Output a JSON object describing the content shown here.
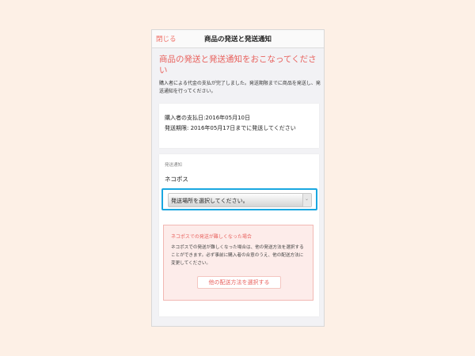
{
  "navbar": {
    "close_label": "閉じる",
    "title": "商品の発送と発送通知"
  },
  "main": {
    "heading": "商品の発送と発送通知をおこなってください",
    "description": "購入者による代金の支払が完了しました。発送期限までに商品を発送し、発送通知を行ってください。"
  },
  "payment": {
    "paid_line": "購入者の支払日:2016年05月10日",
    "deadline_line": "発送期限: 2016年05月17日までに発送してください"
  },
  "shipping": {
    "label": "発送通知",
    "method": "ネコポス",
    "select_placeholder": "発送場所を選択してください。"
  },
  "alert": {
    "title": "ネコポスでの発送が難しくなった場合",
    "body": "ネコポスでの発送が難しくなった場合は、他の発送方法を選択することができます。必ず事前に購入者の合意のうえ、他の配送方法に変更してください。",
    "button_label": "他の配送方法を選択する"
  },
  "colors": {
    "accent": "#e8625e",
    "highlight": "#1aa7e0",
    "background": "#fdf0e6"
  },
  "icons": {
    "select_arrow": "chevron-down-icon"
  }
}
